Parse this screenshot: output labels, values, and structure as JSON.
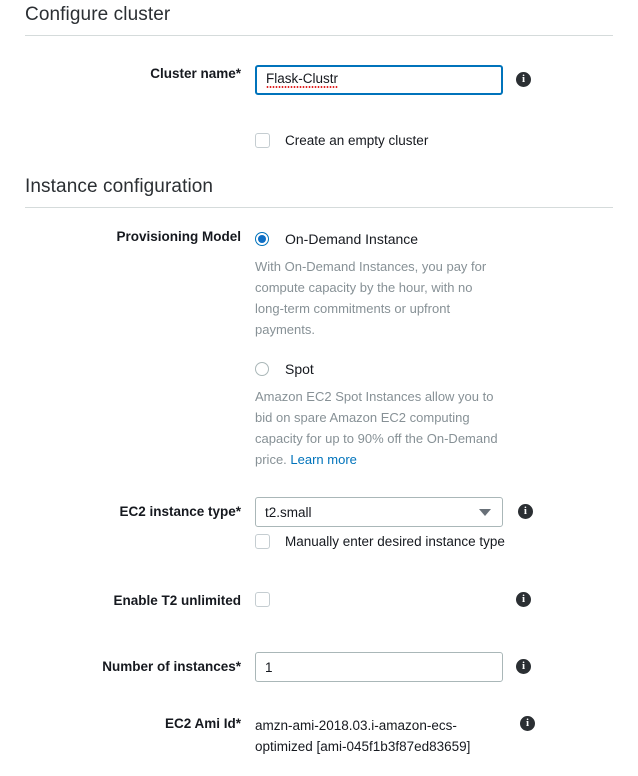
{
  "page": {
    "title": "Configure cluster"
  },
  "cluster_name": {
    "label": "Cluster name*",
    "value": "Flask-Clustr",
    "info_icon": "info-icon"
  },
  "empty_cluster": {
    "label": "Create an empty cluster",
    "checked": false
  },
  "instance_configuration": {
    "title": "Instance configuration"
  },
  "provisioning_model": {
    "label": "Provisioning Model",
    "options": [
      {
        "label": "On-Demand Instance",
        "selected": true,
        "description": "With On-Demand Instances, you pay for compute capacity by the hour, with no long-term commitments or upfront payments."
      },
      {
        "label": "Spot",
        "selected": false,
        "description": "Amazon EC2 Spot Instances allow you to bid on spare Amazon EC2 computing capacity for up to 90% off the On-Demand price. ",
        "link_text": "Learn more"
      }
    ]
  },
  "ec2_instance_type": {
    "label": "EC2 instance type*",
    "value": "t2.small",
    "dropdown_icon": "chevron-down-icon",
    "manual_entry_label": "Manually enter desired instance type",
    "manual_entry_checked": false
  },
  "t2_unlimited": {
    "label": "Enable T2 unlimited",
    "checked": false
  },
  "number_of_instances": {
    "label": "Number of instances*",
    "value": "1"
  },
  "ec2_ami_id": {
    "label": "EC2 Ami Id*",
    "value": "amzn-ami-2018.03.i-amazon-ecs-optimized [ami-045f1b3f87ed83659]"
  },
  "colors": {
    "accent": "#0073bb",
    "link": "#0073bb",
    "text": "#16191f",
    "muted": "#879196",
    "border": "#aab7b8",
    "rule": "#d5dbdb",
    "spell_error": "#e02020"
  }
}
